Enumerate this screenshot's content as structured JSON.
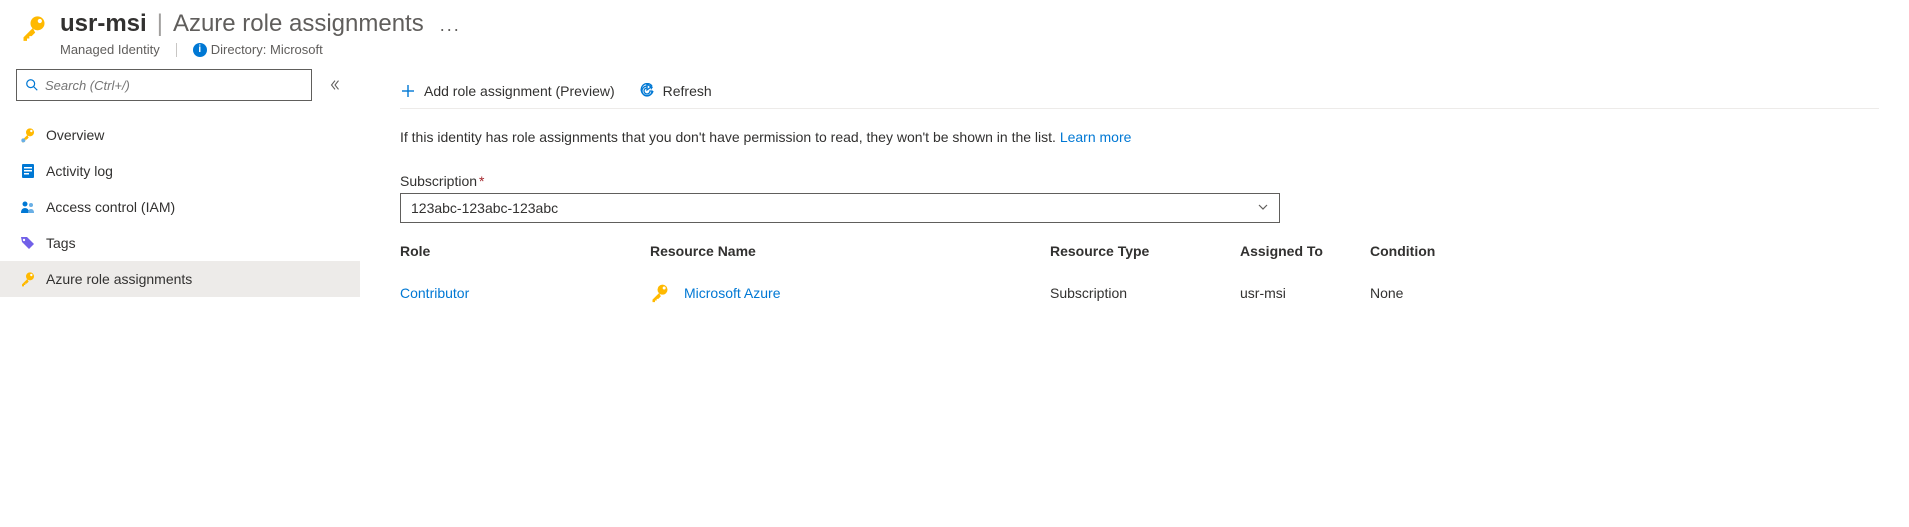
{
  "header": {
    "resource_name": "usr-msi",
    "separator": "|",
    "page_title": "Azure role assignments",
    "more_dots": "...",
    "resource_type": "Managed Identity",
    "directory_label": "Directory:",
    "directory_value": "Microsoft"
  },
  "sidebar": {
    "search_placeholder": "Search (Ctrl+/)",
    "items": [
      {
        "label": "Overview"
      },
      {
        "label": "Activity log"
      },
      {
        "label": "Access control (IAM)"
      },
      {
        "label": "Tags"
      },
      {
        "label": "Azure role assignments"
      }
    ]
  },
  "toolbar": {
    "add_label": "Add role assignment (Preview)",
    "refresh_label": "Refresh"
  },
  "info": {
    "text": "If this identity has role assignments that you don't have permission to read, they won't be shown in the list.",
    "link_label": "Learn more"
  },
  "subscription": {
    "label": "Subscription",
    "value": "123abc-123abc-123abc"
  },
  "table": {
    "headers": {
      "role": "Role",
      "resource": "Resource Name",
      "type": "Resource Type",
      "assigned": "Assigned To",
      "condition": "Condition"
    },
    "rows": [
      {
        "role": "Contributor",
        "resource": "Microsoft Azure",
        "type": "Subscription",
        "assigned": "usr-msi",
        "condition": "None"
      }
    ]
  }
}
